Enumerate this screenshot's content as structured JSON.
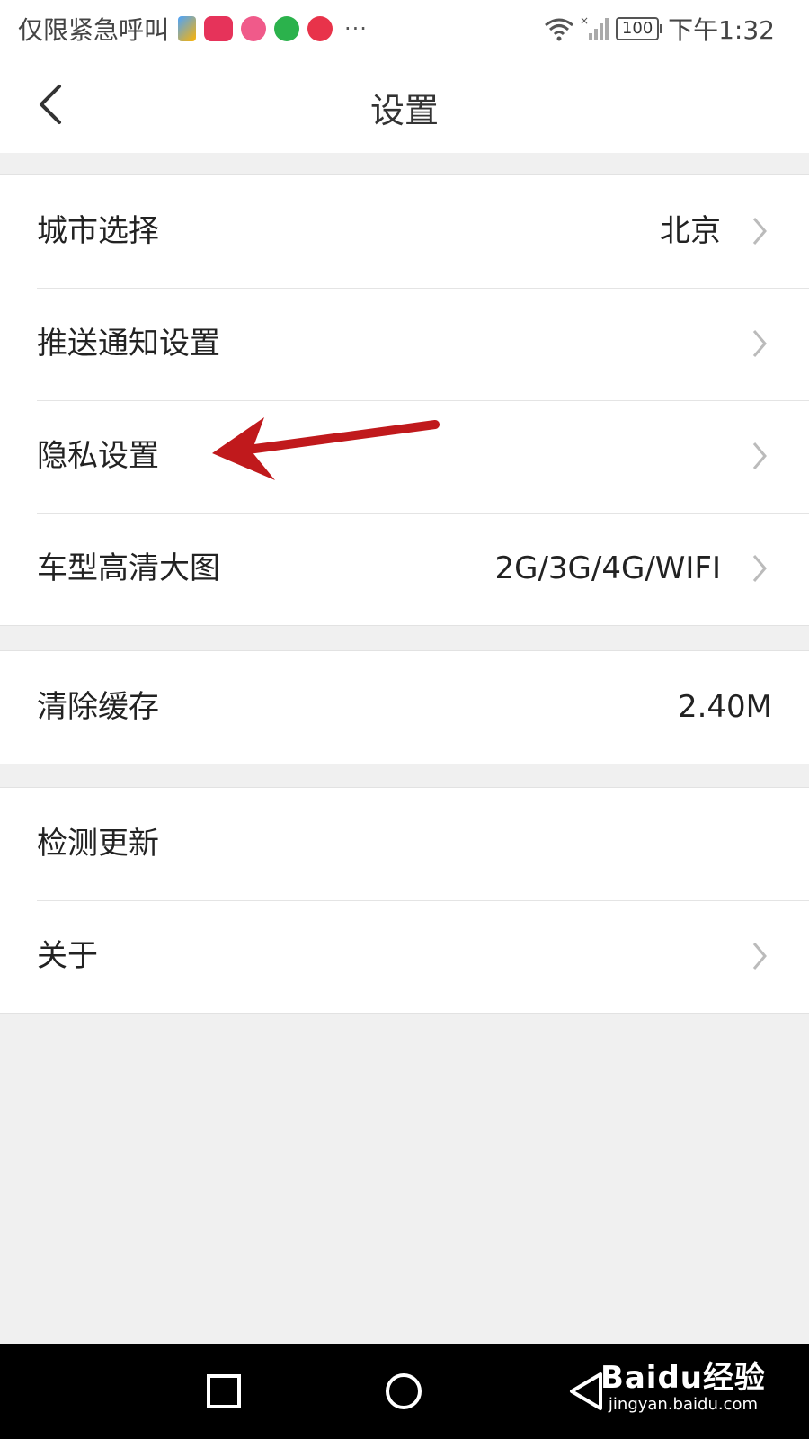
{
  "status_bar": {
    "carrier_text": "仅限紧急呼叫",
    "more_indicator": "···",
    "battery": "100",
    "time": "下午1:32"
  },
  "header": {
    "title": "设置",
    "back_icon": "back-chevron-icon"
  },
  "groups": [
    {
      "rows": [
        {
          "label": "城市选择",
          "value": "北京",
          "has_arrow": true
        },
        {
          "label": "推送通知设置",
          "value": "",
          "has_arrow": true
        },
        {
          "label": "隐私设置",
          "value": "",
          "has_arrow": true
        },
        {
          "label": "车型高清大图",
          "value": "2G/3G/4G/WIFI",
          "has_arrow": true
        }
      ]
    },
    {
      "rows": [
        {
          "label": "清除缓存",
          "value": "2.40M",
          "has_arrow": false
        }
      ]
    },
    {
      "rows": [
        {
          "label": "检测更新",
          "value": "",
          "has_arrow": false
        },
        {
          "label": "关于",
          "value": "",
          "has_arrow": true
        }
      ]
    }
  ],
  "annotation": {
    "color": "#c0191c"
  },
  "watermark": {
    "brand": "Baidu经验",
    "url": "jingyan.baidu.com"
  },
  "colors": {
    "background": "#f0f0f0",
    "row_background": "#ffffff",
    "navbar": "#000000"
  }
}
